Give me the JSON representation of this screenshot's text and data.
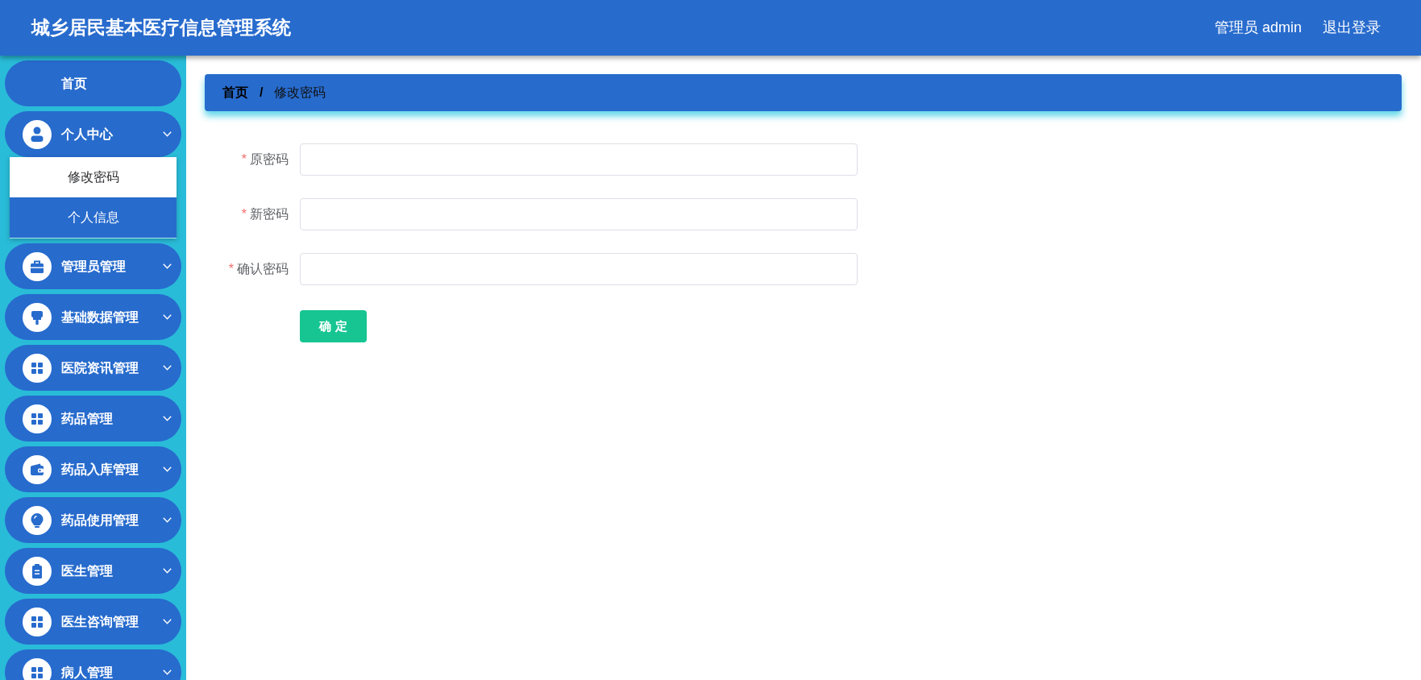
{
  "header": {
    "title": "城乡居民基本医疗信息管理系统",
    "user": "管理员 admin",
    "logout": "退出登录"
  },
  "sidebar": {
    "items": [
      {
        "label": "首页",
        "kind": "link"
      },
      {
        "label": "个人中心",
        "kind": "group",
        "children": [
          {
            "label": "修改密码",
            "selected": true
          },
          {
            "label": "个人信息",
            "selected": false
          }
        ]
      },
      {
        "label": "管理员管理",
        "kind": "group"
      },
      {
        "label": "基础数据管理",
        "kind": "group"
      },
      {
        "label": "医院资讯管理",
        "kind": "group"
      },
      {
        "label": "药品管理",
        "kind": "group"
      },
      {
        "label": "药品入库管理",
        "kind": "group"
      },
      {
        "label": "药品使用管理",
        "kind": "group"
      },
      {
        "label": "医生管理",
        "kind": "group"
      },
      {
        "label": "医生咨询管理",
        "kind": "group"
      },
      {
        "label": "病人管理",
        "kind": "group"
      }
    ]
  },
  "breadcrumb": {
    "separator": "/",
    "items": [
      {
        "label": "首页",
        "link": true
      },
      {
        "label": "修改密码",
        "link": false
      }
    ]
  },
  "form": {
    "required_mark": "*",
    "fields": [
      {
        "label": "原密码",
        "required": true
      },
      {
        "label": "新密码",
        "required": true
      },
      {
        "label": "确认密码",
        "required": true
      }
    ],
    "submit": "确 定"
  }
}
